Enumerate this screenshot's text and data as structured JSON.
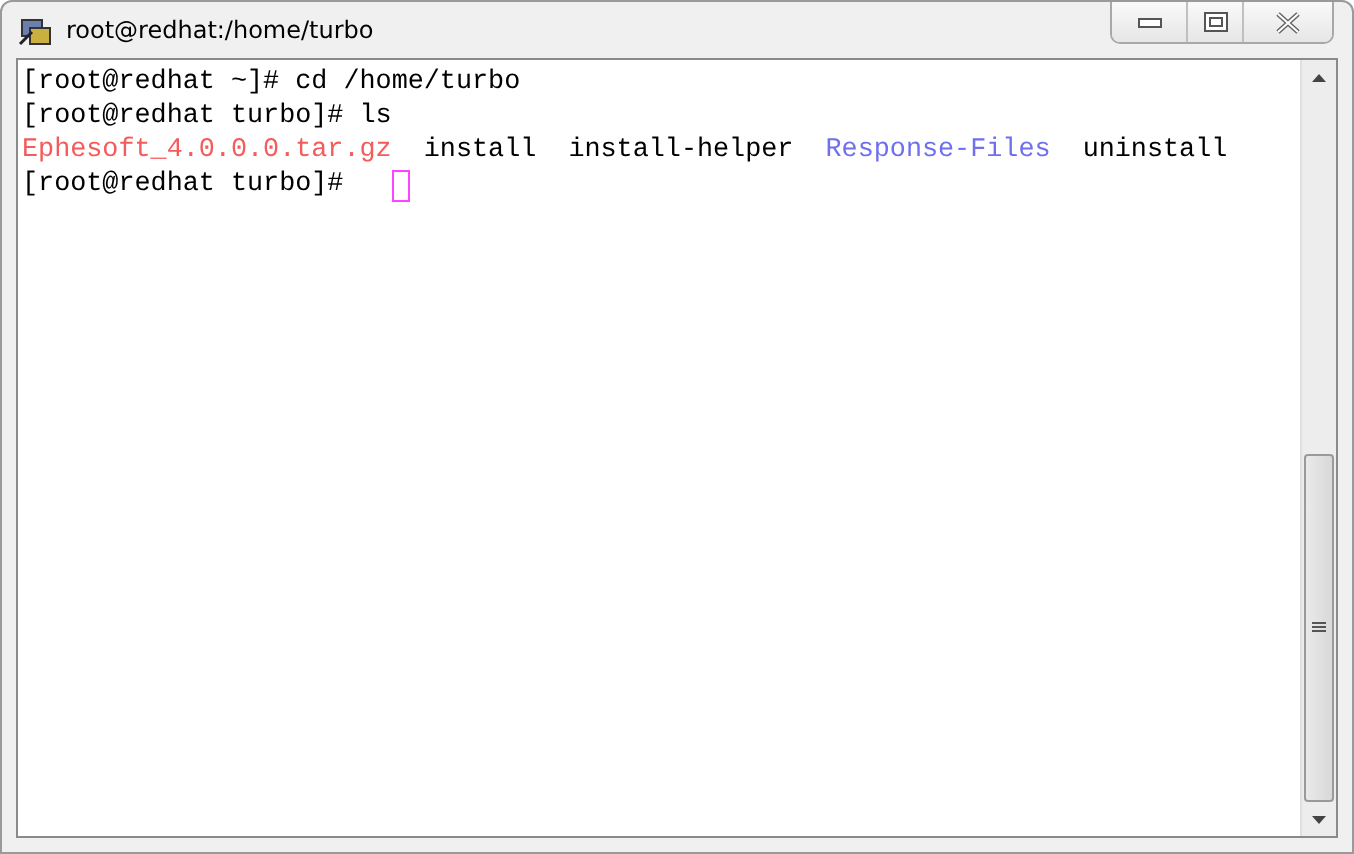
{
  "window": {
    "title": "root@redhat:/home/turbo"
  },
  "terminal": {
    "lines": [
      {
        "segments": [
          {
            "text": "[root@redhat ~]# cd /home/turbo",
            "color": "#000000"
          }
        ]
      },
      {
        "segments": [
          {
            "text": "[root@redhat turbo]# ls",
            "color": "#000000"
          }
        ]
      },
      {
        "segments": [
          {
            "text": "Ephesoft_4.0.0.0.tar.gz",
            "color": "#f55b5b"
          },
          {
            "text": "install",
            "color": "#000000"
          },
          {
            "text": "install-helper",
            "color": "#000000"
          },
          {
            "text": "Response-Files",
            "color": "#7070ee"
          },
          {
            "text": "uninstall",
            "color": "#000000"
          }
        ]
      },
      {
        "segments": [
          {
            "text": "[root@redhat turbo]#",
            "color": "#000000"
          }
        ],
        "cursor": true
      }
    ]
  }
}
